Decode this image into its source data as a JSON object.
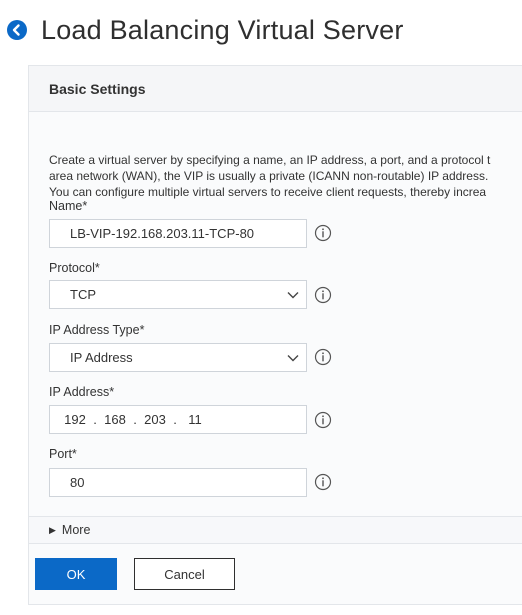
{
  "page": {
    "title": "Load Balancing Virtual Server"
  },
  "icons": {
    "back": "back-arrow-circle-icon",
    "info": "info-circle-icon",
    "chevron": "chevron-down-icon",
    "expand": "triangle-right-icon"
  },
  "colors": {
    "accent": "#0b69c7",
    "back_icon": "#0b69c7"
  },
  "panel": {
    "title": "Basic Settings",
    "description": [
      "Create a virtual server by specifying a name, an IP address, a port, and a protocol t",
      "area network (WAN), the VIP is usually a private (ICANN non-routable) IP address.",
      "You can configure multiple virtual servers to receive client requests, thereby increa"
    ]
  },
  "form": {
    "name": {
      "label": "Name*",
      "value": "LB-VIP-192.168.203.11-TCP-80"
    },
    "protocol": {
      "label": "Protocol*",
      "value": "TCP"
    },
    "ip_address_type": {
      "label": "IP Address Type*",
      "value": "IP Address"
    },
    "ip_address": {
      "label": "IP Address*",
      "octets": [
        "192",
        "168",
        "203",
        "11"
      ],
      "separator": "."
    },
    "port": {
      "label": "Port*",
      "value": "80"
    }
  },
  "more": {
    "label": "More"
  },
  "buttons": {
    "ok": "OK",
    "cancel": "Cancel"
  }
}
